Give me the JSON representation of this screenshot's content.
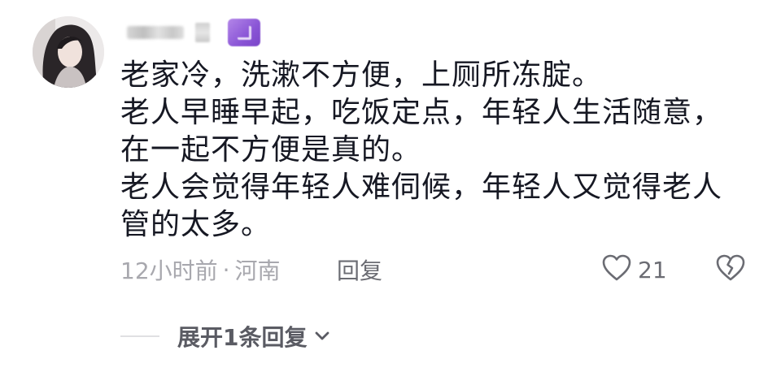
{
  "comment": {
    "username": "",
    "lines": [
      "老家冷，洗漱不方便，上厕所冻腚。",
      "老人早睡早起，吃饭定点，年轻人生活随意，",
      "在一起不方便是真的。",
      "老人会觉得年轻人难伺候，年轻人又觉得老人",
      "管的太多。"
    ],
    "time": "12小时前",
    "separator": "·",
    "location": "河南",
    "reply_label": "回复",
    "like_count": "21",
    "expand_label": "展开1条回复"
  },
  "icons": {
    "like": "heart-outline-icon",
    "dislike": "broken-heart-icon",
    "expand": "chevron-down-icon"
  },
  "colors": {
    "text": "#161823",
    "meta": "#a8a8ae",
    "secondary": "#6b6c73",
    "badge": "#8a55d6"
  }
}
